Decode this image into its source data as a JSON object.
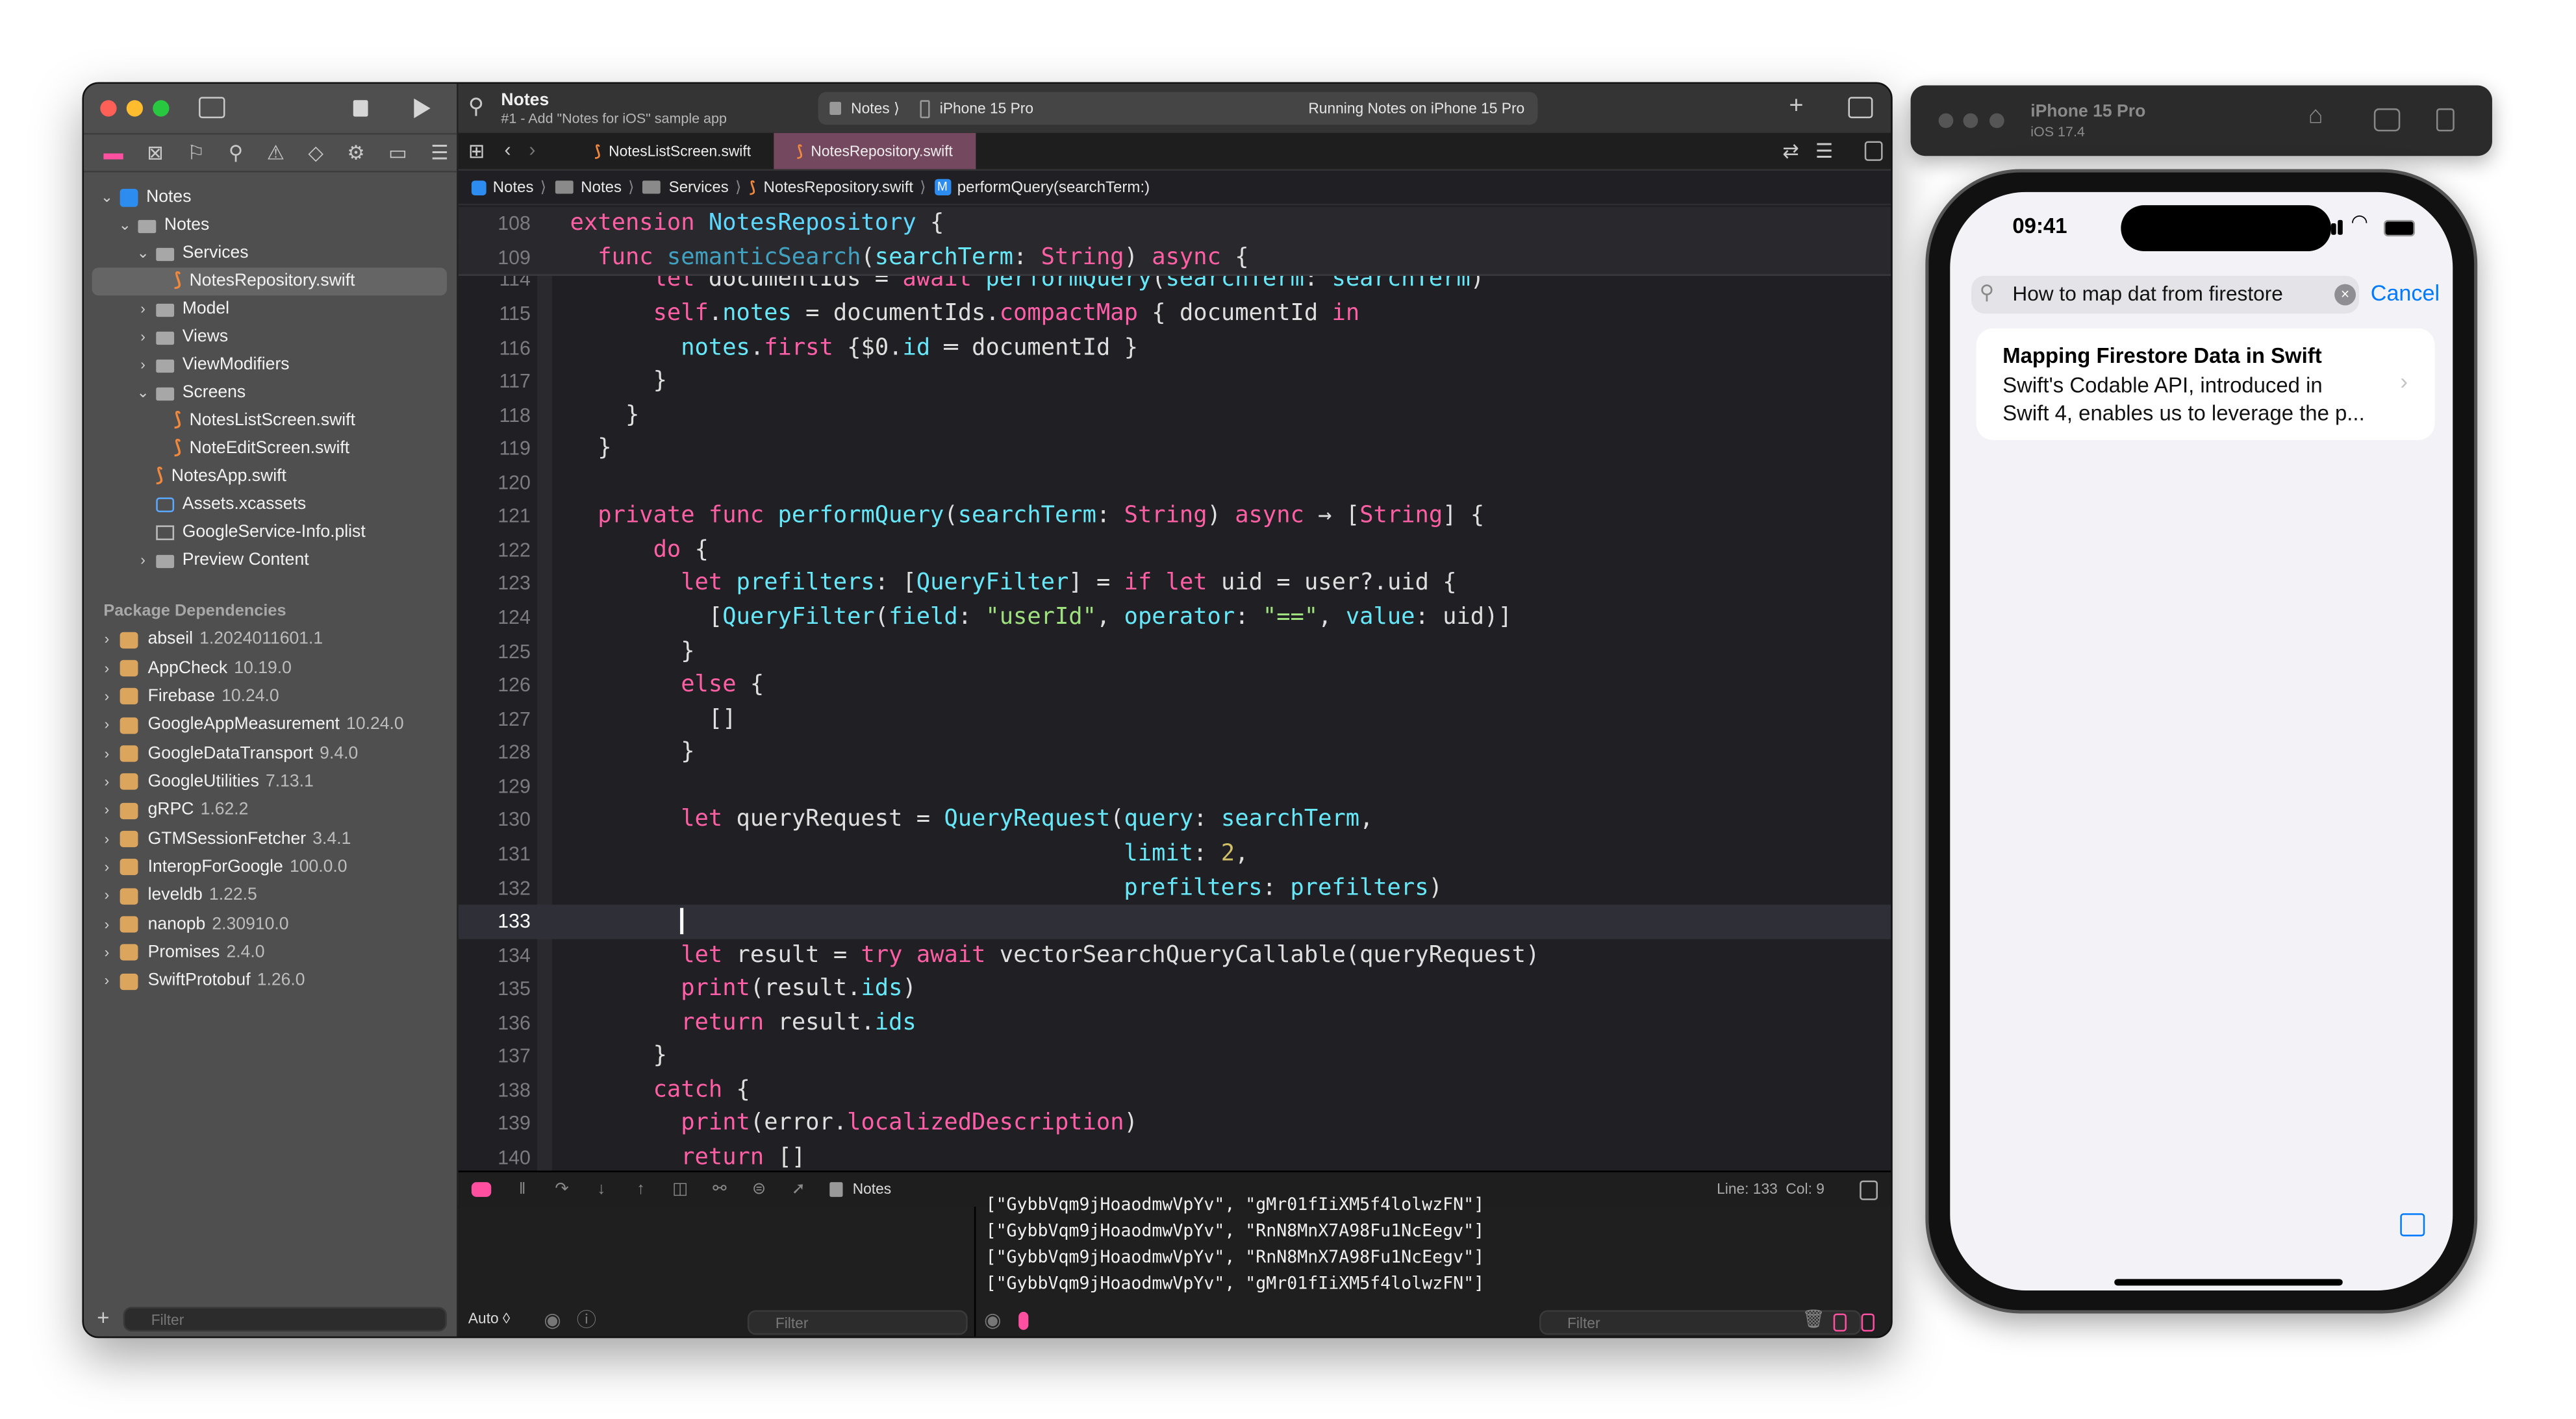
{
  "colors": {
    "keyword": "#fc5fa3",
    "type_decl": "#5dd8ff",
    "decl": "#41a1c0",
    "project": "#67e8f9",
    "method": "#ff5fa8",
    "string": "#9fe07f",
    "number": "#d0bf69",
    "plain": "#dfdfe0",
    "accent_pink": "#ff4fa0",
    "ios_blue": "#007aff",
    "active_tab": "#74485e"
  },
  "xcode": {
    "toolbar": {
      "project_title": "Notes",
      "commit_subtitle": "#1 - Add \"Notes for iOS\" sample app",
      "scheme": "Notes",
      "destination": "iPhone 15 Pro",
      "status": "Running Notes on iPhone 15 Pro",
      "add_label": "+"
    },
    "navigator_icons": [
      "folder-icon",
      "source-control-icon",
      "bookmark-icon",
      "search-icon",
      "warning-icon",
      "test-icon",
      "debug-icon",
      "breakpoint-icon",
      "report-icon"
    ],
    "tree": [
      {
        "label": "Notes",
        "kind": "project",
        "depth": 0,
        "chevron": "down"
      },
      {
        "label": "Notes",
        "kind": "folder",
        "depth": 1,
        "chevron": "down"
      },
      {
        "label": "Services",
        "kind": "folder",
        "depth": 2,
        "chevron": "down"
      },
      {
        "label": "NotesRepository.swift",
        "kind": "swift",
        "depth": 3,
        "selected": true
      },
      {
        "label": "Model",
        "kind": "folder",
        "depth": 2,
        "chevron": "right"
      },
      {
        "label": "Views",
        "kind": "folder",
        "depth": 2,
        "chevron": "right"
      },
      {
        "label": "ViewModifiers",
        "kind": "folder",
        "depth": 2,
        "chevron": "right"
      },
      {
        "label": "Screens",
        "kind": "folder",
        "depth": 2,
        "chevron": "down"
      },
      {
        "label": "NotesListScreen.swift",
        "kind": "swift",
        "depth": 3
      },
      {
        "label": "NoteEditScreen.swift",
        "kind": "swift",
        "depth": 3
      },
      {
        "label": "NotesApp.swift",
        "kind": "swift",
        "depth": 2
      },
      {
        "label": "Assets.xcassets",
        "kind": "assets",
        "depth": 2
      },
      {
        "label": "GoogleService-Info.plist",
        "kind": "plist",
        "depth": 2
      },
      {
        "label": "Preview Content",
        "kind": "folder",
        "depth": 2,
        "chevron": "right"
      }
    ],
    "packages_header": "Package Dependencies",
    "packages": [
      {
        "name": "abseil",
        "version": "1.2024011601.1"
      },
      {
        "name": "AppCheck",
        "version": "10.19.0"
      },
      {
        "name": "Firebase",
        "version": "10.24.0"
      },
      {
        "name": "GoogleAppMeasurement",
        "version": "10.24.0"
      },
      {
        "name": "GoogleDataTransport",
        "version": "9.4.0"
      },
      {
        "name": "GoogleUtilities",
        "version": "7.13.1"
      },
      {
        "name": "gRPC",
        "version": "1.62.2"
      },
      {
        "name": "GTMSessionFetcher",
        "version": "3.4.1"
      },
      {
        "name": "InteropForGoogle",
        "version": "100.0.0"
      },
      {
        "name": "leveldb",
        "version": "1.22.5"
      },
      {
        "name": "nanopb",
        "version": "2.30910.0"
      },
      {
        "name": "Promises",
        "version": "2.4.0"
      },
      {
        "name": "SwiftProtobuf",
        "version": "1.26.0"
      }
    ],
    "sidebar_filter_placeholder": "Filter",
    "tabs": [
      {
        "label": "NotesListScreen.swift",
        "active": false
      },
      {
        "label": "NotesRepository.swift",
        "active": true
      }
    ],
    "breadcrumb": [
      "Notes",
      "Notes",
      "Services",
      "NotesRepository.swift",
      "performQuery(searchTerm:)"
    ],
    "breadcrumb_method_badge": "M",
    "sticky_lines": [
      {
        "num": "108",
        "text": "extension NotesRepository {"
      },
      {
        "num": "109",
        "text": "  func semanticSearch(searchTerm: String) async {"
      }
    ],
    "lines": [
      {
        "num": "114",
        "text": "      let documentIds = await performQuery(searchTerm: searchTerm)"
      },
      {
        "num": "115",
        "text": "      self.notes = documentIds.compactMap { documentId in"
      },
      {
        "num": "116",
        "text": "        notes.first {$0.id == documentId }"
      },
      {
        "num": "117",
        "text": "      }"
      },
      {
        "num": "118",
        "text": "    }"
      },
      {
        "num": "119",
        "text": "  }"
      },
      {
        "num": "120",
        "text": ""
      },
      {
        "num": "121",
        "text": "  private func performQuery(searchTerm: String) async -> [String] {"
      },
      {
        "num": "122",
        "text": "      do {"
      },
      {
        "num": "123",
        "text": "        let prefilters: [QueryFilter] = if let uid = user?.uid {"
      },
      {
        "num": "124",
        "text": "          [QueryFilter(field: \"userId\", operator: \"==\", value: uid)]"
      },
      {
        "num": "125",
        "text": "        }"
      },
      {
        "num": "126",
        "text": "        else {"
      },
      {
        "num": "127",
        "text": "          []"
      },
      {
        "num": "128",
        "text": "        }"
      },
      {
        "num": "129",
        "text": ""
      },
      {
        "num": "130",
        "text": "        let queryRequest = QueryRequest(query: searchTerm,"
      },
      {
        "num": "131",
        "text": "                                        limit: 2,"
      },
      {
        "num": "132",
        "text": "                                        prefilters: prefilters)"
      },
      {
        "num": "133",
        "text": "        ",
        "current": true
      },
      {
        "num": "134",
        "text": "        let result = try await vectorSearchQueryCallable(queryRequest)"
      },
      {
        "num": "135",
        "text": "        print(result.ids)"
      },
      {
        "num": "136",
        "text": "        return result.ids"
      },
      {
        "num": "137",
        "text": "      }"
      },
      {
        "num": "138",
        "text": "      catch {"
      },
      {
        "num": "139",
        "text": "        print(error.localizedDescription)"
      },
      {
        "num": "140",
        "text": "        return []"
      }
    ],
    "syntax": {
      "keyword": [
        "extension",
        "func",
        "async",
        "private",
        "let",
        "await",
        "in",
        "do",
        "if",
        "else",
        "try",
        "return",
        "catch",
        "self",
        "String"
      ],
      "type_decl": [
        "NotesRepository"
      ],
      "decl": [
        "semanticSearch"
      ],
      "project": [
        "performQuery",
        "searchTerm",
        "notes",
        "QueryFilter",
        "QueryRequest",
        "query",
        "limit",
        "prefilters",
        "ids",
        "field",
        "operator",
        "value",
        "id"
      ],
      "method": [
        "compactMap",
        "first",
        "print",
        "localizedDescription"
      ]
    },
    "debug_bar": {
      "target": "Notes",
      "position": "Line: 133  Col: 9"
    },
    "console_lines": [
      "[\"GybbVqm9jHoaodmwVpYv\", \"gMr01fIiXM5f4lolwzFN\"]",
      "[\"GybbVqm9jHoaodmwVpYv\", \"RnN8MnX7A98Fu1NcEegv\"]",
      "[\"GybbVqm9jHoaodmwVpYv\", \"RnN8MnX7A98Fu1NcEegv\"]",
      "[\"GybbVqm9jHoaodmwVpYv\", \"gMr01fIiXM5f4lolwzFN\"]"
    ],
    "variables_scope": "Auto ◊",
    "variables_filter_placeholder": "Filter",
    "console_filter_placeholder": "Filter"
  },
  "simulator": {
    "device": "iPhone 15 Pro",
    "os": "iOS 17.4",
    "time": "09:41",
    "search_text": "How to map dat from firestore",
    "cancel_label": "Cancel",
    "results": [
      {
        "title": "Mapping Firestore Data in Swift",
        "snippet_1": "Swift's Codable API, introduced in",
        "snippet_2": "Swift 4, enables us to leverage the p..."
      }
    ]
  }
}
